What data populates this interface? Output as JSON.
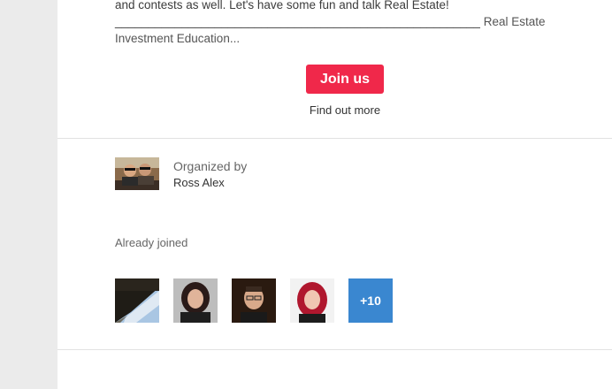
{
  "description": {
    "line1": "and contests as well. Let's have some fun and talk Real Estate!",
    "line2_rule": "_______________________________________________________",
    "line2_text": "Real Estate",
    "line3": "Investment Education..."
  },
  "actions": {
    "join_label": "Join us",
    "find_out_more": "Find out more"
  },
  "organizer": {
    "label": "Organized by",
    "name": "Ross Alex"
  },
  "attendees": {
    "label": "Already joined",
    "more_count": "+10"
  },
  "colors": {
    "join_button": "#f0284a",
    "more_badge": "#3a87d0"
  }
}
